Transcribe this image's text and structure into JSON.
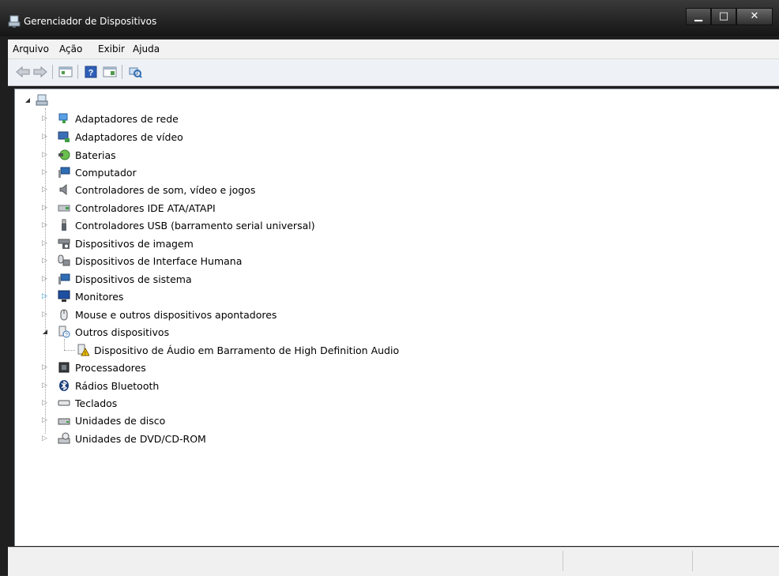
{
  "window": {
    "title": "Gerenciador de Dispositivos"
  },
  "menu": [
    "Arquivo",
    "Ação",
    "Exibir",
    "Ajuda"
  ],
  "toolbar": {
    "icons": [
      "back-icon",
      "forward-icon",
      "properties-icon",
      "help-icon",
      "view-icon",
      "scan-hardware-icon"
    ]
  },
  "tree": {
    "root_icon": "computer-icon",
    "categories": [
      {
        "label": "Adaptadores de rede",
        "icon": "network-adapter-icon"
      },
      {
        "label": "Adaptadores de vídeo",
        "icon": "display-adapter-icon"
      },
      {
        "label": "Baterias",
        "icon": "battery-icon"
      },
      {
        "label": "Computador",
        "icon": "computer-icon"
      },
      {
        "label": "Controladores de som, vídeo e jogos",
        "icon": "speaker-icon"
      },
      {
        "label": "Controladores IDE ATA/ATAPI",
        "icon": "ide-controller-icon"
      },
      {
        "label": "Controladores USB (barramento serial universal)",
        "icon": "usb-icon"
      },
      {
        "label": "Dispositivos de imagem",
        "icon": "camera-icon"
      },
      {
        "label": "Dispositivos de Interface Humana",
        "icon": "hid-icon"
      },
      {
        "label": "Dispositivos de sistema",
        "icon": "system-device-icon"
      },
      {
        "label": "Monitores",
        "icon": "monitor-icon"
      },
      {
        "label": "Mouse e outros dispositivos apontadores",
        "icon": "mouse-icon"
      },
      {
        "label": "Outros dispositivos",
        "icon": "unknown-device-icon"
      },
      {
        "label": "Dispositivo de Áudio em Barramento de High Definition Audio",
        "icon": "warning-device-icon"
      },
      {
        "label": "Processadores",
        "icon": "processor-icon"
      },
      {
        "label": "Rádios Bluetooth",
        "icon": "bluetooth-icon"
      },
      {
        "label": "Teclados",
        "icon": "keyboard-icon"
      },
      {
        "label": "Unidades de disco",
        "icon": "disk-drive-icon"
      },
      {
        "label": "Unidades de DVD/CD-ROM",
        "icon": "dvd-drive-icon"
      }
    ]
  },
  "colors": {
    "selected_expander": "#2f9bd6",
    "warning": "#f5c400"
  }
}
